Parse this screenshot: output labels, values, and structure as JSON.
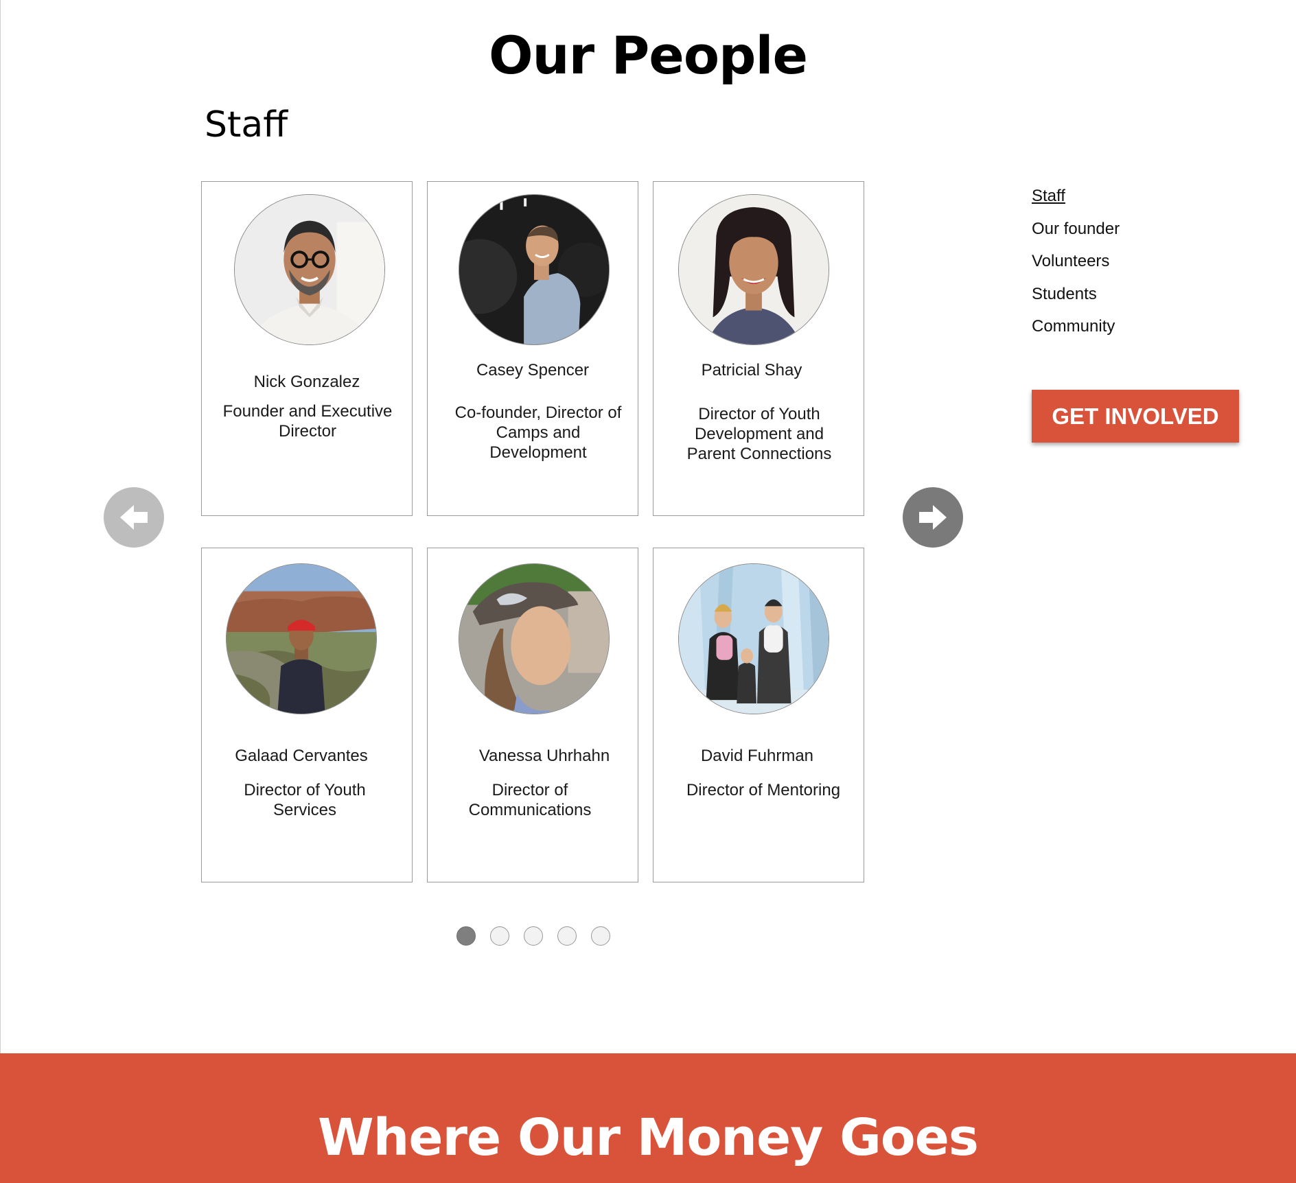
{
  "page": {
    "title": "Our People",
    "section_title": "Staff"
  },
  "staff": [
    {
      "name": "Nick Gonzalez",
      "role": "Founder and Executive Director"
    },
    {
      "name": "Casey Spencer",
      "role": "Co-founder, Director of Camps and Development"
    },
    {
      "name": "Patricial Shay",
      "role": "Director of Youth Development and Parent Connections"
    },
    {
      "name": "Galaad Cervantes",
      "role": "Director of Youth Services"
    },
    {
      "name": "Vanessa Uhrhahn",
      "role": "Director of Communications"
    },
    {
      "name": "David Fuhrman",
      "role": "Director of Mentoring"
    }
  ],
  "carousel": {
    "prev_icon": "arrow-left-icon",
    "next_icon": "arrow-right-icon",
    "page_count": 5,
    "active_page": 1
  },
  "side_nav": {
    "items": [
      "Staff",
      "Our founder",
      "Volunteers",
      "Students",
      "Community"
    ],
    "active": "Staff"
  },
  "cta": {
    "label": "GET INVOLVED"
  },
  "footer": {
    "title": "Where Our Money Goes"
  },
  "colors": {
    "accent": "#d9533a",
    "arrow_disabled": "#bdbdbd",
    "arrow_enabled": "#7a7a7a"
  }
}
